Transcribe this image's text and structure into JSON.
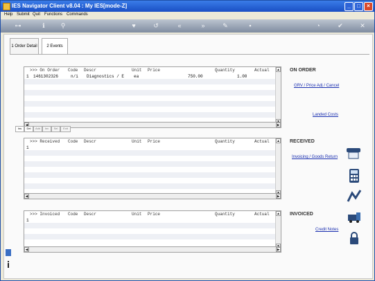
{
  "window": {
    "title": "IES Navigator Client v8.04 : My IES :",
    "mode": "[mode-Z]",
    "controls": [
      "minimize-icon",
      "maximize-icon",
      "close-icon"
    ]
  },
  "menu": [
    "Help",
    "Submit",
    "Quit",
    "Functions",
    "Commands"
  ],
  "toolbar_icons": [
    "key-icon",
    "info-icon",
    "search-icon",
    "heart-icon",
    "undo-icon",
    "rewind-icon",
    "fast-forward-icon",
    "edit-icon",
    "save-icon",
    "globe-icon",
    "check-icon",
    "close-icon"
  ],
  "tabs": [
    {
      "label": "1 Order Detail",
      "active": false
    },
    {
      "label": "2 Events",
      "active": true
    }
  ],
  "columns": {
    "code": "Code",
    "descr": "Descr",
    "unit": "Unit",
    "price": "Price",
    "quantity": "Quantity",
    "actual": "Actual"
  },
  "sections": {
    "on_order": {
      "grid_label": ">>> On Order",
      "title": "ON ORDER",
      "links": [
        "GRV / Price Adj / Cancel",
        "Landed Costs"
      ],
      "rows": [
        {
          "num": "1",
          "order": "1461302326",
          "code": "n/i",
          "descr": "Diagnostics / E",
          "unit": "ea",
          "price": "750.00",
          "quantity": "1.00",
          "actual": ""
        }
      ]
    },
    "received": {
      "grid_label": ">>> Received",
      "title": "RECEIVED",
      "links": [
        "Invoicing / Goods Return"
      ],
      "rows": [
        {
          "num": "1"
        }
      ]
    },
    "invoiced": {
      "grid_label": ">>> Invoiced",
      "title": "INVOICED",
      "links": [
        "Credit Notes"
      ],
      "rows": [
        {
          "num": "1"
        }
      ]
    }
  },
  "mini_toolbar": [
    "Ins",
    "Del",
    "Add",
    "Inv",
    "Sel",
    "Exit"
  ]
}
